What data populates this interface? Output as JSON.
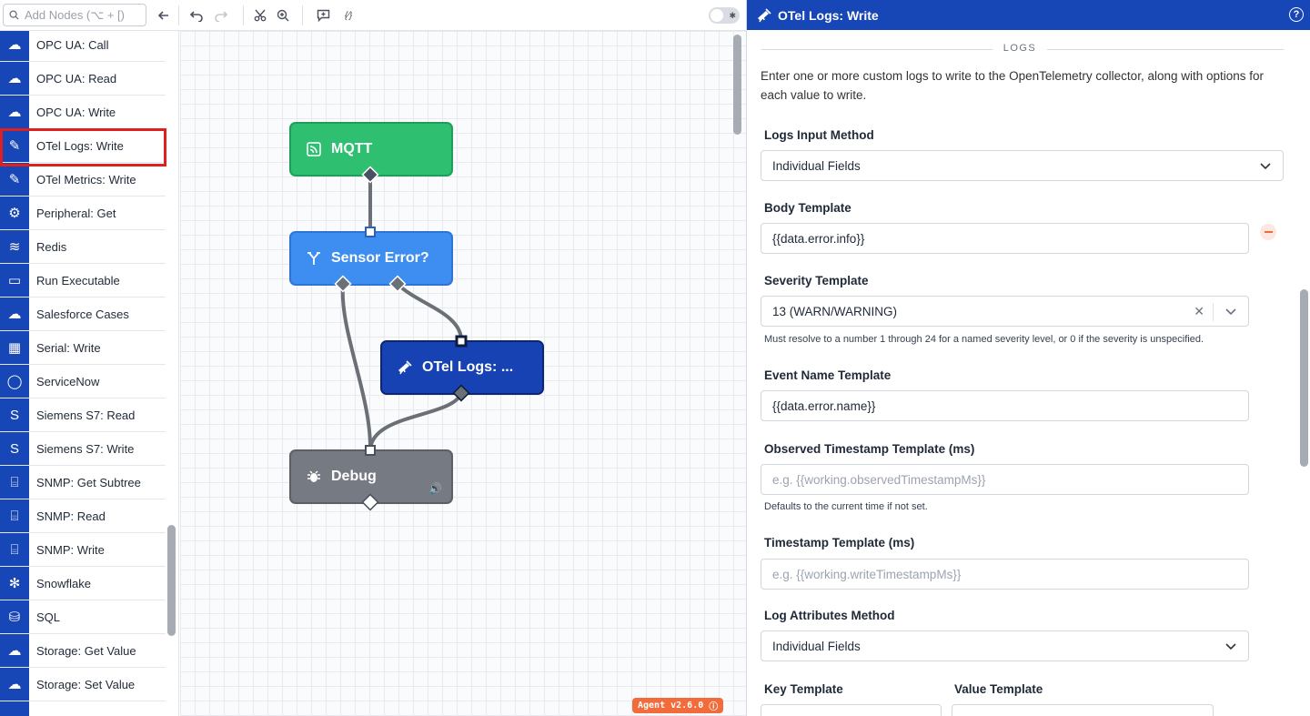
{
  "toolbar": {
    "search_placeholder": "Add Nodes (⌥ + [)",
    "debug_toggle_icon": "bug-icon"
  },
  "palette": {
    "items": [
      {
        "label": "OPC UA: Call",
        "icon": "☁"
      },
      {
        "label": "OPC UA: Read",
        "icon": "☁"
      },
      {
        "label": "OPC UA: Write",
        "icon": "☁"
      },
      {
        "label": "OTel Logs: Write",
        "icon": "✎",
        "selected": true
      },
      {
        "label": "OTel Metrics: Write",
        "icon": "✎"
      },
      {
        "label": "Peripheral: Get",
        "icon": "⚙"
      },
      {
        "label": "Redis",
        "icon": "≋"
      },
      {
        "label": "Run Executable",
        "icon": "▭"
      },
      {
        "label": "Salesforce Cases",
        "icon": "☁"
      },
      {
        "label": "Serial: Write",
        "icon": "▦"
      },
      {
        "label": "ServiceNow",
        "icon": "◯"
      },
      {
        "label": "Siemens S7: Read",
        "icon": "S"
      },
      {
        "label": "Siemens S7: Write",
        "icon": "S"
      },
      {
        "label": "SNMP: Get Subtree",
        "icon": "⌸"
      },
      {
        "label": "SNMP: Read",
        "icon": "⌸"
      },
      {
        "label": "SNMP: Write",
        "icon": "⌸"
      },
      {
        "label": "Snowflake",
        "icon": "✻"
      },
      {
        "label": "SQL",
        "icon": "⛁"
      },
      {
        "label": "Storage: Get Value",
        "icon": "☁"
      },
      {
        "label": "Storage: Set Value",
        "icon": "☁"
      },
      {
        "label": "",
        "icon": ""
      }
    ]
  },
  "canvas": {
    "nodes": {
      "mqtt": "MQTT",
      "sensor": "Sensor Error?",
      "otel": "OTel Logs: ...",
      "debug": "Debug"
    },
    "agent_badge": "Agent v2.6.0"
  },
  "panel": {
    "title": "OTel Logs: Write",
    "section": "LOGS",
    "description": "Enter one or more custom logs to write to the OpenTelemetry collector, along with options for each value to write.",
    "logs_input_method": {
      "label": "Logs Input Method",
      "value": "Individual Fields"
    },
    "body_template": {
      "label": "Body Template",
      "value": "{{data.error.info}}"
    },
    "severity_template": {
      "label": "Severity Template",
      "value": "13 (WARN/WARNING)",
      "hint": "Must resolve to a number 1 through 24 for a named severity level, or 0 if the severity is unspecified."
    },
    "event_name_template": {
      "label": "Event Name Template",
      "value": "{{data.error.name}}"
    },
    "observed_timestamp": {
      "label": "Observed Timestamp Template (ms)",
      "placeholder": "e.g. {{working.observedTimestampMs}}",
      "hint": "Defaults to the current time if not set."
    },
    "timestamp": {
      "label": "Timestamp Template (ms)",
      "placeholder": "e.g. {{working.writeTimestampMs}}"
    },
    "log_attributes_method": {
      "label": "Log Attributes Method",
      "value": "Individual Fields"
    },
    "key_template": {
      "label": "Key Template"
    },
    "value_template": {
      "label": "Value Template"
    }
  },
  "colors": {
    "brand_blue": "#1746b6",
    "mqtt_green": "#2fbf71",
    "conditional_blue": "#3d8ef0",
    "debug_gray": "#767a82",
    "highlight_red": "#e02020",
    "accent_orange": "#f26b3a"
  }
}
